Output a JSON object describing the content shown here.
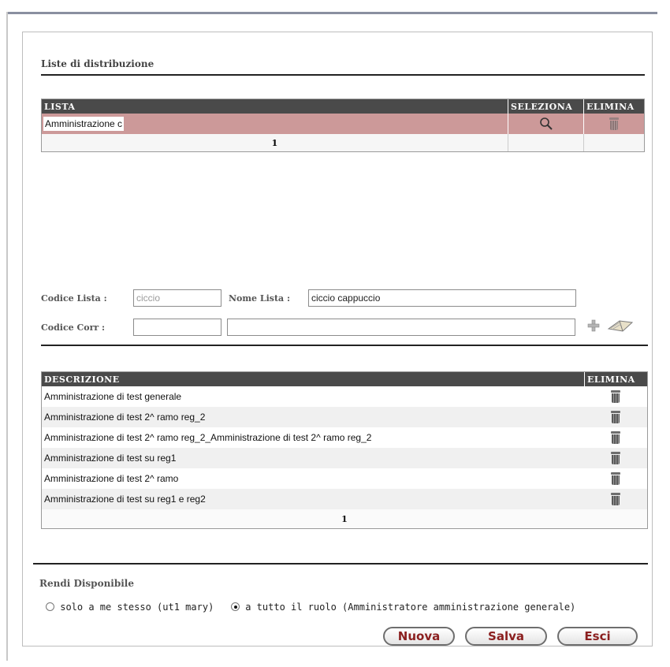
{
  "distribution": {
    "section_title": "Liste di distribuzione",
    "columns": {
      "lista": "LISTA",
      "seleziona": "SELEZIONA",
      "elimina": "ELIMINA"
    },
    "rows": [
      {
        "lista": "Amministrazione c"
      }
    ],
    "page": "1",
    "selected_row_color": "#cc9999"
  },
  "form": {
    "codice_lista_label": "Codice Lista :",
    "codice_lista_value": "ciccio",
    "nome_lista_label": "Nome Lista :",
    "nome_lista_value": "ciccio cappuccio",
    "codice_corr_label": "Codice Corr :",
    "codice_corr_value": "",
    "desc_corr_value": ""
  },
  "recipients": {
    "columns": {
      "descrizione": "DESCRIZIONE",
      "elimina": "ELIMINA"
    },
    "rows": [
      {
        "descrizione": "Amministrazione di test generale"
      },
      {
        "descrizione": "Amministrazione di test 2^ ramo reg_2"
      },
      {
        "descrizione": "Amministrazione di test 2^ ramo reg_2_Amministrazione di test 2^ ramo reg_2"
      },
      {
        "descrizione": "Amministrazione di test su reg1"
      },
      {
        "descrizione": "Amministrazione di test 2^ ramo"
      },
      {
        "descrizione": "Amministrazione di test su reg1 e reg2"
      }
    ],
    "page": "1"
  },
  "availability": {
    "title": "Rendi Disponibile",
    "option_me": "solo a me stesso (ut1 mary)",
    "option_role": "a tutto il ruolo (Amministratore amministrazione generale)",
    "selected": "role"
  },
  "buttons": {
    "nuova": "Nuova",
    "salva": "Salva",
    "esci": "Esci"
  },
  "colors": {
    "header_bg": "#4a4a4a",
    "button_text": "#8b1f1f",
    "row_alt": "#f0f0f0"
  }
}
